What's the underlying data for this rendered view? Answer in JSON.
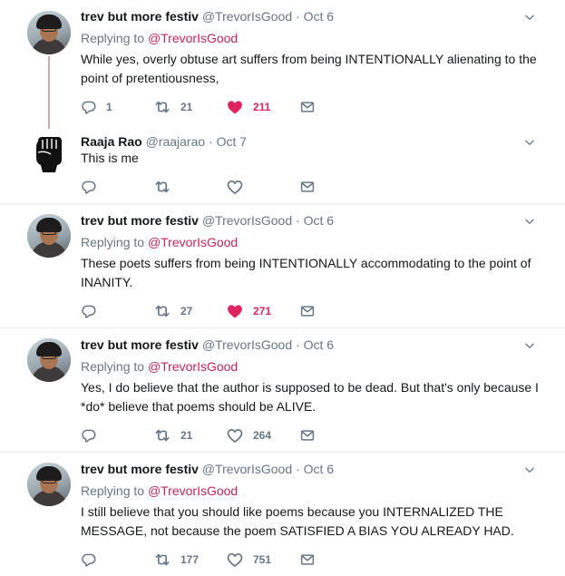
{
  "colors": {
    "accent_like": "#e0245e",
    "muted": "#657786",
    "separator": "#e6ecf0",
    "reply_handle": "#c2255c"
  },
  "icons": {
    "reply": "reply-icon",
    "retweet": "retweet-icon",
    "like": "heart-icon",
    "dm": "envelope-icon",
    "caret": "chevron-down-icon"
  },
  "tweets": [
    {
      "name": "trev but more festiv",
      "handle": "@TrevorIsGood",
      "sep": " · ",
      "date": "Oct 6",
      "replying_label": "Replying to ",
      "replying_handle": "@TrevorIsGood",
      "text": "While yes, overly obtuse art suffers from being INTENTIONALLY alienating to the point of pretentiousness,",
      "replies": "1",
      "retweets": "21",
      "likes": "211",
      "liked": true
    },
    {
      "name": "Raaja Rao",
      "handle": "@raajarao",
      "sep": " · ",
      "date": "Oct 7",
      "text": "This is me",
      "replies": "",
      "retweets": "",
      "likes": "",
      "liked": false
    },
    {
      "name": "trev but more festiv",
      "handle": "@TrevorIsGood",
      "sep": " · ",
      "date": "Oct 6",
      "replying_label": "Replying to ",
      "replying_handle": "@TrevorIsGood",
      "text": "These poets suffers from being INTENTIONALLY accommodating to the point of INANITY.",
      "replies": "",
      "retweets": "27",
      "likes": "271",
      "liked": true
    },
    {
      "name": "trev but more festiv",
      "handle": "@TrevorIsGood",
      "sep": " · ",
      "date": "Oct 6",
      "replying_label": "Replying to ",
      "replying_handle": "@TrevorIsGood",
      "text": "Yes, I do believe that the author is supposed to be dead. But that's only because I *do* believe that poems should be ALIVE.",
      "replies": "",
      "retweets": "21",
      "likes": "264",
      "liked": false
    },
    {
      "name": "trev but more festiv",
      "handle": "@TrevorIsGood",
      "sep": " · ",
      "date": "Oct 6",
      "replying_label": "Replying to ",
      "replying_handle": "@TrevorIsGood",
      "text": "I still believe that you should like poems because you INTERNALIZED THE MESSAGE, not because the poem SATISFIED A BIAS YOU ALREADY HAD.",
      "replies": "",
      "retweets": "177",
      "likes": "751",
      "liked": false
    }
  ]
}
